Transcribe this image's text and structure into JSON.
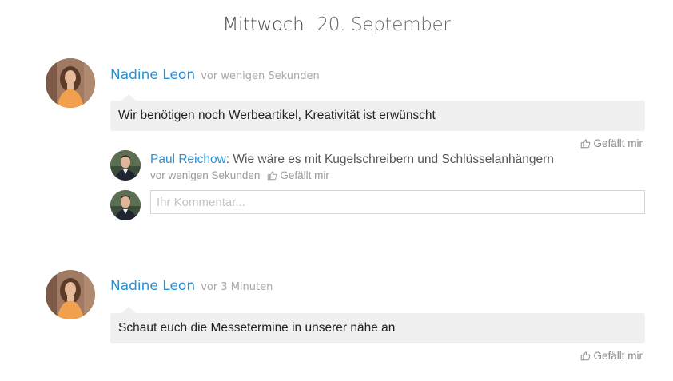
{
  "date_header": {
    "weekday": "Mittwoch",
    "day": "20. September"
  },
  "posts": [
    {
      "author": "Nadine Leon",
      "time": "vor wenigen Sekunden",
      "message": "Wir benötigen noch Werbeartikel, Kreativität ist erwünscht",
      "like_label": "Gefällt mir",
      "comments": [
        {
          "author": "Paul Reichow",
          "text": "Wie wäre es mit Kugelschreibern und Schlüsselanhängern",
          "time": "vor wenigen Sekunden",
          "like_label": "Gefällt mir"
        }
      ],
      "comment_input": {
        "placeholder": "Ihr Kommentar..."
      }
    },
    {
      "author": "Nadine Leon",
      "time": "vor 3 Minuten",
      "message": "Schaut euch die Messetermine in unserer nähe an",
      "like_label": "Gefällt mir"
    }
  ],
  "colors": {
    "accent": "#2b8fd0",
    "bubble_bg": "#f0f0f0",
    "muted": "#a8a8a8"
  },
  "icons": {
    "like": "thumbs-up-icon"
  }
}
